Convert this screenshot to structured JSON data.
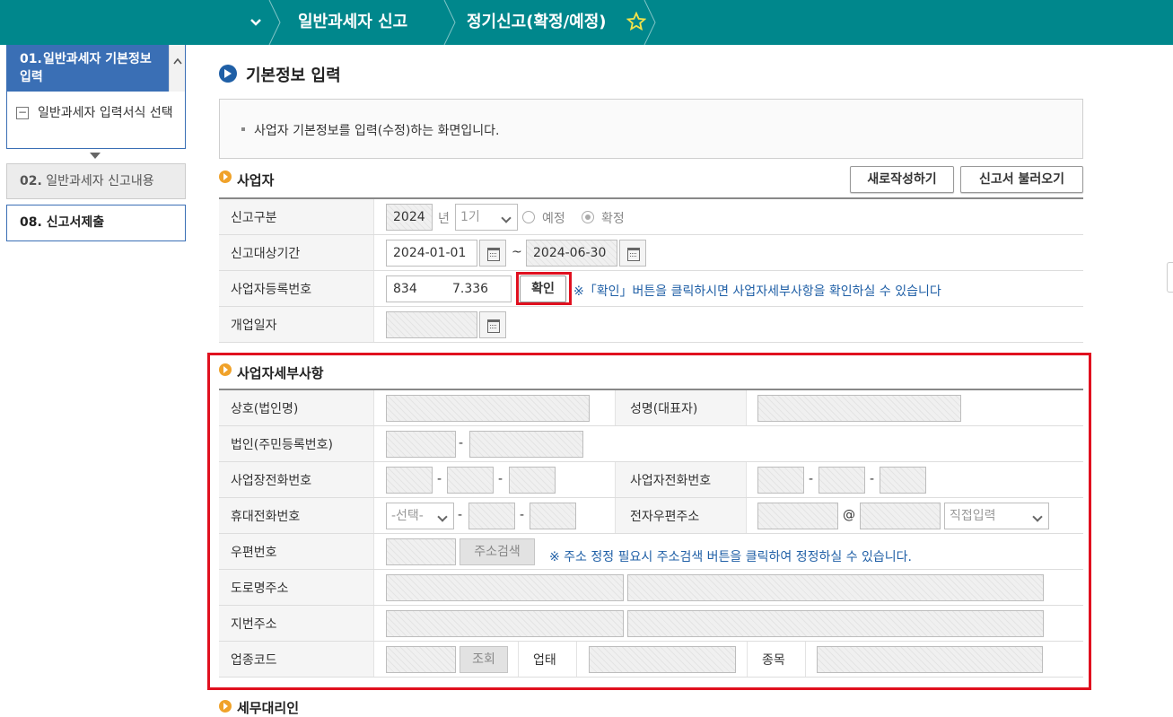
{
  "topbar": {
    "nav1": "일반과세자 신고",
    "nav2": "정기신고(확정/예정)"
  },
  "sidebar": {
    "step1_num": "01.",
    "step1_label": "일반과세자 기본정보 입력",
    "step1_sub": "일반과세자 입력서식 선택",
    "step2_num": "02.",
    "step2_label": "일반과세자 신고내용",
    "step8_num": "08.",
    "step8_label": "신고서제출"
  },
  "page": {
    "title": "기본정보 입력",
    "info": "사업자 기본정보를 입력(수정)하는 화면입니다."
  },
  "business": {
    "section_title": "사업자",
    "new_button": "새로작성하기",
    "load_button": "신고서 불러오기",
    "report_type_label": "신고구분",
    "year": "2024",
    "year_unit": "년",
    "period": "1기",
    "radio_prelim": "예정",
    "radio_final": "확정",
    "period_label": "신고대상기간",
    "start_date": "2024-01-01",
    "tilde": "~",
    "end_date": "2024-06-30",
    "reg_no_label": "사업자등록번호",
    "reg_no_a": "834",
    "reg_no_b": "7.336",
    "confirm_button": "확인",
    "confirm_note": "※「확인」버튼을 클릭하시면 사업자세부사항을 확인하실 수 있습니다",
    "open_date_label": "개업일자"
  },
  "details": {
    "section_title": "사업자세부사항",
    "trade_name_label": "상호(법인명)",
    "rep_name_label": "성명(대표자)",
    "corp_no_label": "법인(주민등록번호)",
    "site_phone_label": "사업장전화번호",
    "biz_phone_label": "사업자전화번호",
    "mobile_label": "휴대전화번호",
    "mobile_select": "-선택-",
    "email_label": "전자우편주소",
    "email_at": "@",
    "email_domain_select": "직접입력",
    "zip_label": "우편번호",
    "address_search_button": "주소검색",
    "address_note": "※ 주소 정정 필요시 주소검색 버튼을 클릭하여 정정하실 수 있습니다.",
    "road_address_label": "도로명주소",
    "lot_address_label": "지번주소",
    "industry_code_label": "업종코드",
    "lookup_button": "조회",
    "business_type_label": "업태",
    "item_label": "종목",
    "dash": "-"
  },
  "tax_agent": {
    "section_title": "세무대리인"
  }
}
